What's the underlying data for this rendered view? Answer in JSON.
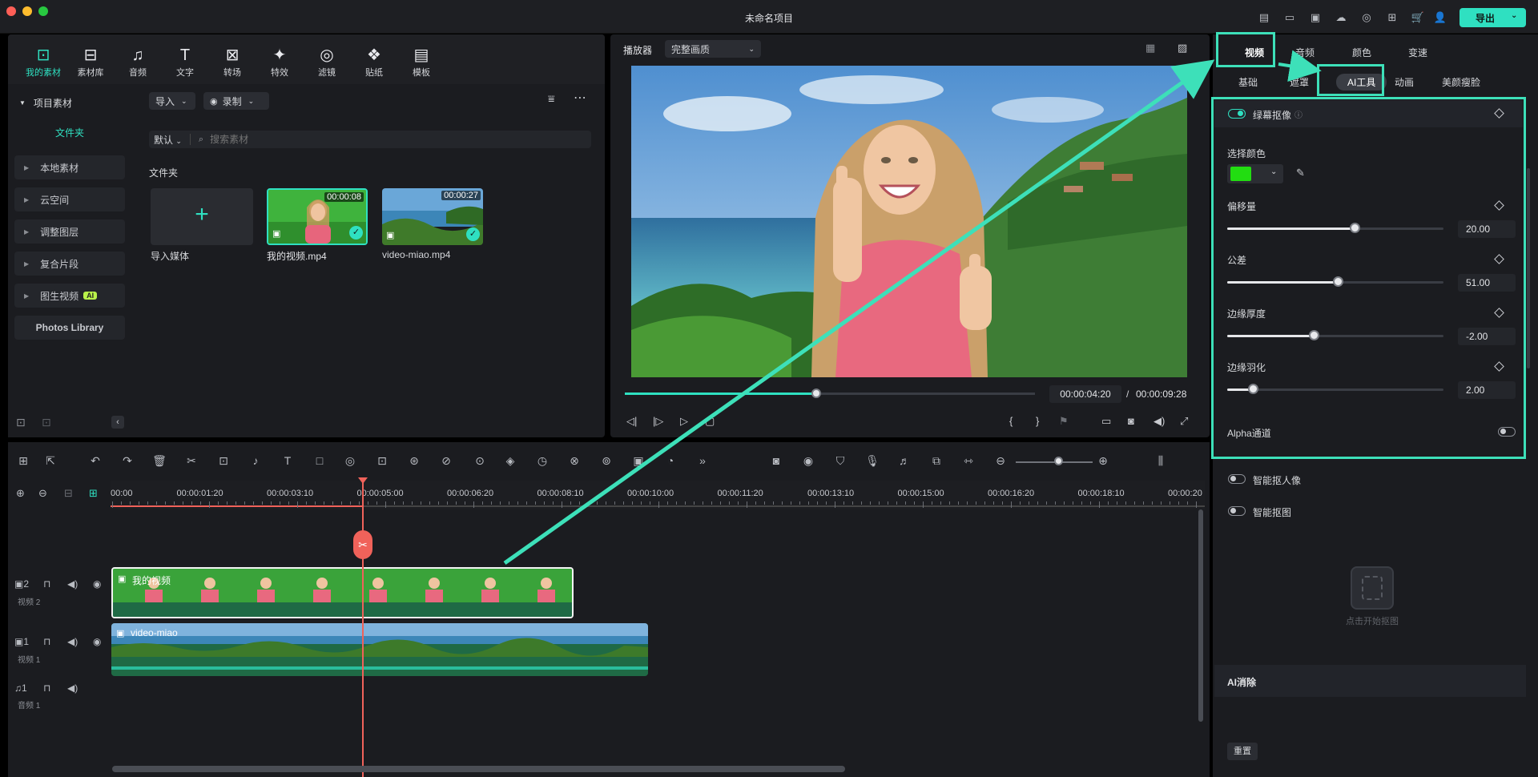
{
  "window": {
    "title": "未命名项目",
    "export_label": "导出"
  },
  "colors": {
    "accent": "#2fe0c1",
    "highlight": "#3de0b9",
    "playhead": "#f0625a",
    "key_color": "#22dd11"
  },
  "media_tabs": [
    {
      "label": "我的素材",
      "icon": "media-icon"
    },
    {
      "label": "素材库",
      "icon": "stock-icon"
    },
    {
      "label": "音频",
      "icon": "music-icon"
    },
    {
      "label": "文字",
      "icon": "text-icon"
    },
    {
      "label": "转场",
      "icon": "transition-icon"
    },
    {
      "label": "特效",
      "icon": "effects-icon"
    },
    {
      "label": "滤镜",
      "icon": "filter-icon"
    },
    {
      "label": "贴纸",
      "icon": "sticker-icon"
    },
    {
      "label": "模板",
      "icon": "template-icon"
    }
  ],
  "sidebar": {
    "project_media": "项目素材",
    "folder": "文件夹",
    "items": [
      "本地素材",
      "云空间",
      "调整图层",
      "复合片段",
      "图生视频"
    ],
    "ai_badge": "AI",
    "photos": "Photos Library"
  },
  "media_toolbar": {
    "import": "导入",
    "record": "录制",
    "sort": "默认",
    "search_placeholder": "搜索素材",
    "folder_heading": "文件夹"
  },
  "media_items": [
    {
      "name": "导入媒体"
    },
    {
      "name": "我的视频.mp4",
      "duration": "00:00:08"
    },
    {
      "name": "video-miao.mp4",
      "duration": "00:00:27"
    }
  ],
  "player": {
    "label": "播放器",
    "quality": "完整画质",
    "current_time": "00:00:04:20",
    "separator": "/",
    "total_time": "00:00:09:28",
    "progress": 0.466
  },
  "right_panel": {
    "tabs": [
      "视频",
      "音频",
      "颜色",
      "变速"
    ],
    "subtabs": [
      "基础",
      "遮罩",
      "AI工具",
      "动画",
      "美颜瘦脸"
    ],
    "chroma": {
      "title": "绿幕抠像",
      "select_color": "选择颜色",
      "params": [
        {
          "label": "偏移量",
          "value": "20.00",
          "level": 0.59
        },
        {
          "label": "公差",
          "value": "51.00",
          "level": 0.51
        },
        {
          "label": "边缘厚度",
          "value": "-2.00",
          "level": 0.4
        },
        {
          "label": "边缘羽化",
          "value": "2.00",
          "level": 0.12
        }
      ],
      "alpha": "Alpha通道"
    },
    "smart_cutout": "智能抠人像",
    "smart_matting": "智能抠图",
    "start_matting": "点击开始抠图",
    "ai_erase": "AI消除",
    "reset": "重置"
  },
  "timeline": {
    "ticks": [
      "00:00",
      "00:00:01:20",
      "00:00:03:10",
      "00:00:05:00",
      "00:00:06:20",
      "00:00:08:10",
      "00:00:10:00",
      "00:00:11:20",
      "00:00:13:10",
      "00:00:15:00",
      "00:00:16:20",
      "00:00:18:10",
      "00:00:20"
    ],
    "tracks": [
      {
        "num": "2",
        "name": "视频 2",
        "clip": "我的视频"
      },
      {
        "num": "1",
        "name": "视频 1",
        "clip": "video-miao"
      },
      {
        "num": "1",
        "name": "音频 1"
      }
    ]
  }
}
